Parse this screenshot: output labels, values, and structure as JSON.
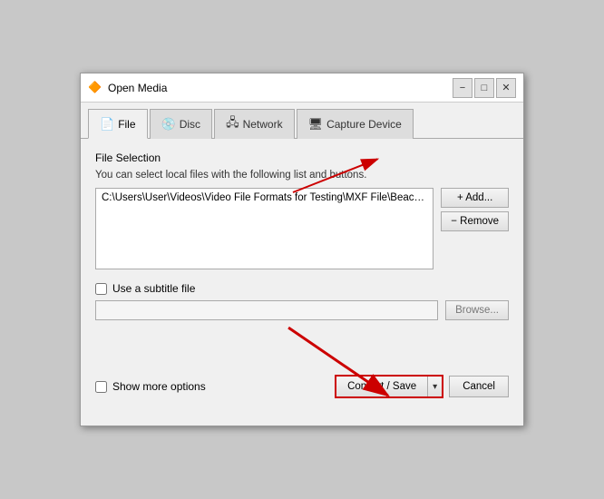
{
  "window": {
    "title": "Open Media",
    "title_icon": "📂",
    "controls": {
      "minimize": "−",
      "maximize": "□",
      "close": "✕"
    }
  },
  "tabs": [
    {
      "id": "file",
      "label": "File",
      "icon": "📄",
      "active": true
    },
    {
      "id": "disc",
      "label": "Disc",
      "icon": "💿",
      "active": false
    },
    {
      "id": "network",
      "label": "Network",
      "icon": "🖧",
      "active": false
    },
    {
      "id": "capture",
      "label": "Capture Device",
      "icon": "🖥",
      "active": false
    }
  ],
  "file_tab": {
    "section_title": "File Selection",
    "description": "You can select local files with the following list and buttons.",
    "file_path": "C:\\Users\\User\\Videos\\Video File Formats for Testing\\MXF File\\Beach...",
    "add_button": "+ Add...",
    "remove_button": "− Remove",
    "subtitle": {
      "checkbox_label": "Use a subtitle file",
      "checked": false,
      "placeholder": "",
      "browse_button": "Browse..."
    }
  },
  "bottom": {
    "show_more_checkbox_label": "Show more options",
    "show_more_checked": false,
    "convert_save_label": "Convert / Save",
    "convert_arrow": "▾",
    "cancel_label": "Cancel"
  }
}
